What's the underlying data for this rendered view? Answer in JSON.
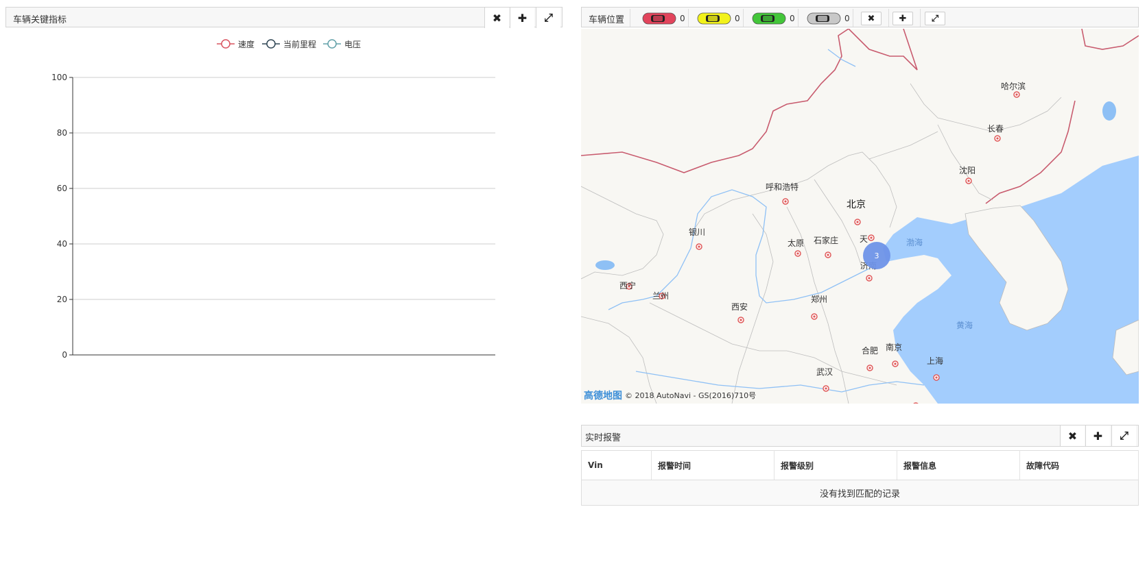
{
  "chart_panel": {
    "title": "车辆关键指标",
    "buttons": {
      "close": "✖",
      "add": "✚",
      "expand": "⤢"
    }
  },
  "chart_data": {
    "type": "line",
    "series": [
      {
        "name": "速度",
        "color": "#d9535f",
        "values": []
      },
      {
        "name": "当前里程",
        "color": "#2f4554",
        "values": []
      },
      {
        "name": "电压",
        "color": "#61a0a8",
        "values": []
      }
    ],
    "ylim": [
      0,
      100
    ],
    "yticks": [
      0,
      20,
      40,
      60,
      80,
      100
    ],
    "grid": true,
    "legend_position": "top-center"
  },
  "map_panel": {
    "title": "车辆位置",
    "car_counts": [
      {
        "color": "#e2445c",
        "icon": "car-red-icon",
        "count": "0"
      },
      {
        "color": "#f2f21a",
        "icon": "car-yellow-icon",
        "count": "0"
      },
      {
        "color": "#43c63a",
        "icon": "car-green-icon",
        "count": "0"
      },
      {
        "color": "#c8c8c8",
        "icon": "car-gray-icon",
        "count": "0"
      }
    ],
    "buttons": {
      "close": "✖",
      "add": "✚",
      "expand": "⤢"
    },
    "cities": [
      "哈尔滨",
      "长春",
      "沈阳",
      "呼和浩特",
      "北京",
      "天",
      "银川",
      "太原",
      "石家庄",
      "济南",
      "西宁",
      "兰州",
      "西安",
      "郑州",
      "合肥",
      "南京",
      "上海",
      "武汉"
    ],
    "seas": [
      "渤海",
      "黄海"
    ],
    "cluster_count": "3",
    "logo": "高德地图",
    "copyright": "© 2018 AutoNavi - GS(2016)710号"
  },
  "alarm_panel": {
    "title": "实时报警",
    "buttons": {
      "close": "✖",
      "add": "✚",
      "expand": "⤢"
    },
    "columns": [
      "Vin",
      "报警时间",
      "报警级别",
      "报警信息",
      "故障代码"
    ],
    "empty_message": "没有找到匹配的记录"
  }
}
